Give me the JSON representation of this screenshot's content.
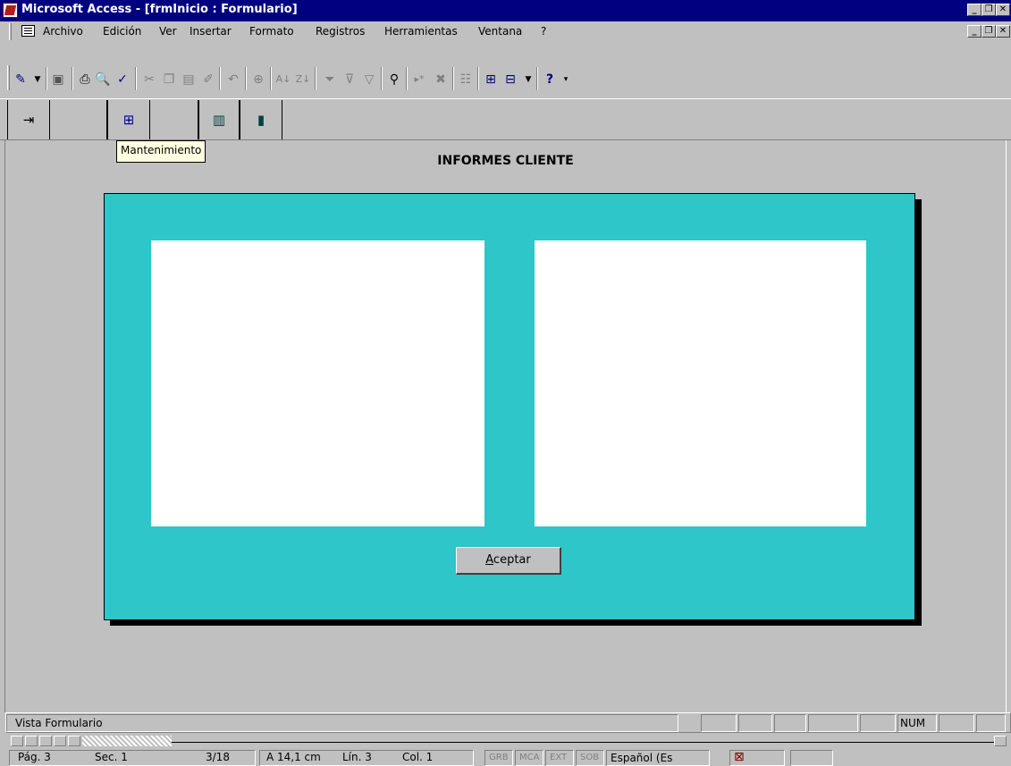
{
  "window": {
    "title": "Microsoft Access - [frmInicio : Formulario]",
    "minimize_glyph": "_",
    "restore_glyph": "❐",
    "close_glyph": "✕"
  },
  "menu": {
    "items": [
      "Archivo",
      "Edición",
      "Ver",
      "Insertar",
      "Formato",
      "Registros",
      "Herramientas",
      "Ventana",
      "?"
    ]
  },
  "toolbar": {
    "icons": [
      "view-icon",
      "dropdown-arrow-icon",
      "save-icon",
      "print-icon",
      "print-preview-icon",
      "spelling-icon",
      "cut-icon",
      "copy-icon",
      "paste-icon",
      "format-painter-icon",
      "undo-icon",
      "hyperlink-icon",
      "sort-ascending-icon",
      "sort-descending-icon",
      "filter-by-selection-icon",
      "filter-by-form-icon",
      "apply-filter-icon",
      "find-icon",
      "new-record-icon",
      "delete-record-icon",
      "properties-icon",
      "database-window-icon",
      "new-object-icon",
      "help-icon"
    ]
  },
  "nav_toolbar": {
    "icons": [
      "exit-icon",
      "form-icon",
      "books-icon",
      "book-icon"
    ]
  },
  "tooltip": {
    "text": "Mantenimiento"
  },
  "form": {
    "title": "INFORMES CLIENTE",
    "accept_button": {
      "underlined": "A",
      "rest": "ceptar"
    },
    "colors": {
      "panel": "#2ec6c8",
      "background": "#c0c0c0"
    }
  },
  "status_bar": {
    "text": "Vista Formulario",
    "num": "NUM"
  },
  "word_status": {
    "page": "Pág. 3",
    "section": "Sec. 1",
    "pages": "3/18",
    "position": "A 14,1 cm",
    "line": "Lín. 3",
    "column": "Col. 1",
    "grb": "GRB",
    "mca": "MCA",
    "ext": "EXT",
    "sob": "SOB",
    "language": "Español (Es"
  }
}
